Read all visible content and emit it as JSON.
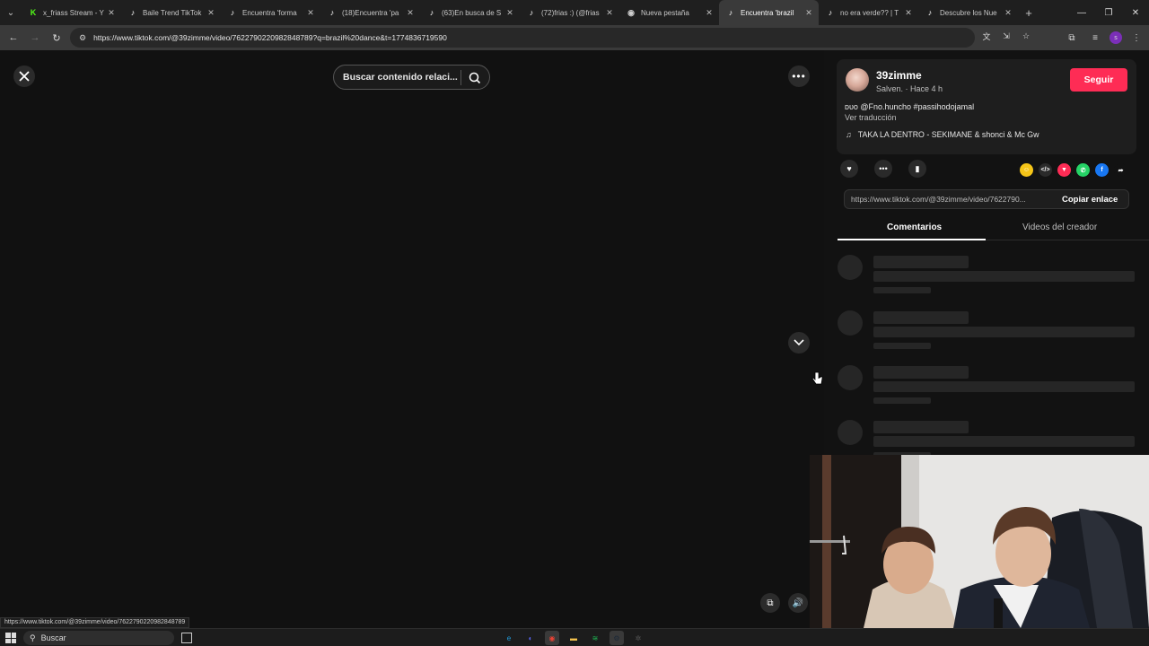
{
  "browser": {
    "tabs": [
      {
        "label": "x_friass Stream - Y",
        "icon": "kick-icon",
        "color": "#53fc18",
        "glyph": "K"
      },
      {
        "label": "Baile Trend TikTok",
        "icon": "tiktok-icon",
        "color": "#ffffff",
        "glyph": "♪"
      },
      {
        "label": "Encuentra 'forma",
        "icon": "tiktok-icon",
        "color": "#ffffff",
        "glyph": "♪"
      },
      {
        "label": "(18)Encuentra 'pa",
        "icon": "tiktok-icon",
        "color": "#ffffff",
        "glyph": "♪"
      },
      {
        "label": "(63)En busca de S",
        "icon": "tiktok-icon",
        "color": "#ffffff",
        "glyph": "♪"
      },
      {
        "label": "(72)frias :) (@frias",
        "icon": "tiktok-icon",
        "color": "#ffffff",
        "glyph": "♪"
      },
      {
        "label": "Nueva pestaña",
        "icon": "chrome-icon",
        "color": "#cfcfcf",
        "glyph": "◉"
      },
      {
        "label": "Encuentra 'brazil",
        "icon": "tiktok-icon",
        "color": "#ffffff",
        "glyph": "♪"
      },
      {
        "label": "no era verde?? | T",
        "icon": "tiktok-icon",
        "color": "#ffffff",
        "glyph": "♪"
      },
      {
        "label": "Descubre los Nue",
        "icon": "tiktok-icon",
        "color": "#ffffff",
        "glyph": "♪"
      }
    ],
    "active_tab": 7,
    "url": "https://www.tiktok.com/@39zimme/video/7622790220982848789?q=brazil%20dance&t=1774836719590"
  },
  "page": {
    "search_placeholder": "Buscar contenido relaci...",
    "status_url": "https://www.tiktok.com/@39zimme/video/7622790220982848789"
  },
  "author": {
    "username": "39zimme",
    "meta": "Salven. · Hace 4 h",
    "follow_label": "Seguir",
    "description": "ᴅᴜᴏ @Fno.huncho #passihodojamal",
    "translate_label": "Ver traducción",
    "music": "TAKA LA DENTRO - SEKIMANE & shonci & Mc Gw"
  },
  "share": {
    "link": "https://www.tiktok.com/@39zimme/video/7622790...",
    "copy_label": "Copiar enlace",
    "icons": [
      {
        "name": "friends-share-icon",
        "color": "#f5c518",
        "glyph": "☺"
      },
      {
        "name": "embed-icon",
        "color": "#2a2a2a",
        "glyph": "</>"
      },
      {
        "name": "send-icon",
        "color": "#fe2c55",
        "glyph": "▼"
      },
      {
        "name": "whatsapp-icon",
        "color": "#25d366",
        "glyph": "✆"
      },
      {
        "name": "facebook-icon",
        "color": "#1877f2",
        "glyph": "f"
      },
      {
        "name": "share-arrow-icon",
        "color": "#121212",
        "glyph": "➦"
      }
    ]
  },
  "panel_tabs": {
    "comments": "Comentarios",
    "creator_videos": "Videos del creador"
  },
  "taskbar": {
    "search": "Buscar",
    "apps": [
      {
        "name": "edge-icon",
        "color": "#1fa0e3",
        "glyph": "e"
      },
      {
        "name": "discord-icon",
        "color": "#5865f2",
        "glyph": "◐"
      },
      {
        "name": "chrome-taskbar-icon",
        "color": "#ea4335",
        "glyph": "◉"
      },
      {
        "name": "file-explorer-icon",
        "color": "#f2c14e",
        "glyph": "▬"
      },
      {
        "name": "spotify-icon",
        "color": "#1db954",
        "glyph": "≋"
      },
      {
        "name": "steam-icon",
        "color": "#1b2838",
        "glyph": "⚙"
      },
      {
        "name": "settings-icon",
        "color": "#555555",
        "glyph": "✲"
      }
    ]
  }
}
